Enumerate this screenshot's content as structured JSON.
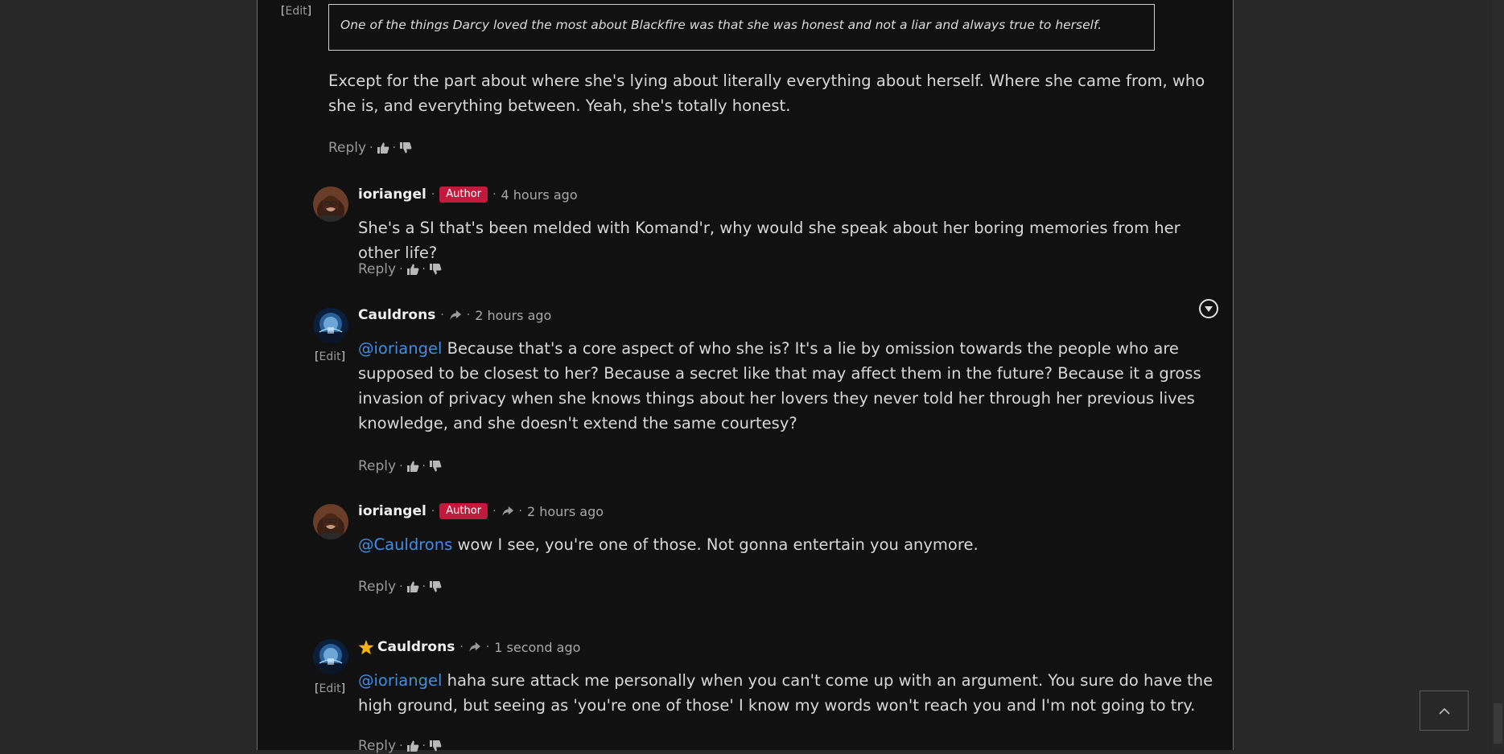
{
  "edit_label": "Edit",
  "quote_text": "One of the things Darcy loved the most about Blackfire was that she was honest and not a liar and always true to herself.",
  "comment0": {
    "text": "Except for the part about where she's lying about literally everything about herself. Where she came from, who she is, and everything between. Yeah, she's totally honest.",
    "reply_label": "Reply"
  },
  "comment1": {
    "username": "ioriangel",
    "badge": "Author",
    "time": "4 hours ago",
    "text": "She's a SI that's been melded with Komand'r, why would she speak about her boring memories from her other life?",
    "reply_label": "Reply"
  },
  "comment2": {
    "username": "Cauldrons",
    "time": "2 hours ago",
    "mention": "@ioriangel",
    "text": " Because that's a core aspect of who she is? It's a lie by omission towards the people who are supposed to be closest to her? Because a secret like that may affect them in the future? Because it a gross invasion of privacy when she knows things about her lovers they never told her through her previous lives knowledge, and she doesn't extend the same courtesy?",
    "reply_label": "Reply"
  },
  "comment3": {
    "username": "ioriangel",
    "badge": "Author",
    "time": "2 hours ago",
    "mention": "@Cauldrons",
    "text": " wow I see, you're one of those. Not gonna entertain you anymore.",
    "reply_label": "Reply"
  },
  "comment4": {
    "username": "Cauldrons",
    "time": "1 second ago",
    "mention": "@ioriangel",
    "text": " haha sure attack me personally when you can't come up with an argument. You sure do have the high ground, but seeing as 'you're one of those' I know my words won't reach you and I'm not going to try.",
    "reply_label": "Reply"
  },
  "icons": {
    "upvote": "thumbs-up-icon",
    "downvote": "thumbs-down-icon",
    "share": "share-arrow-icon",
    "star": "star-icon",
    "collapse": "chevron-down-circle-icon",
    "scroll_top": "chevron-up-icon"
  },
  "colors": {
    "mention": "#3f8fe5",
    "author_badge": "#c01a3d",
    "star": "#f5b400"
  }
}
